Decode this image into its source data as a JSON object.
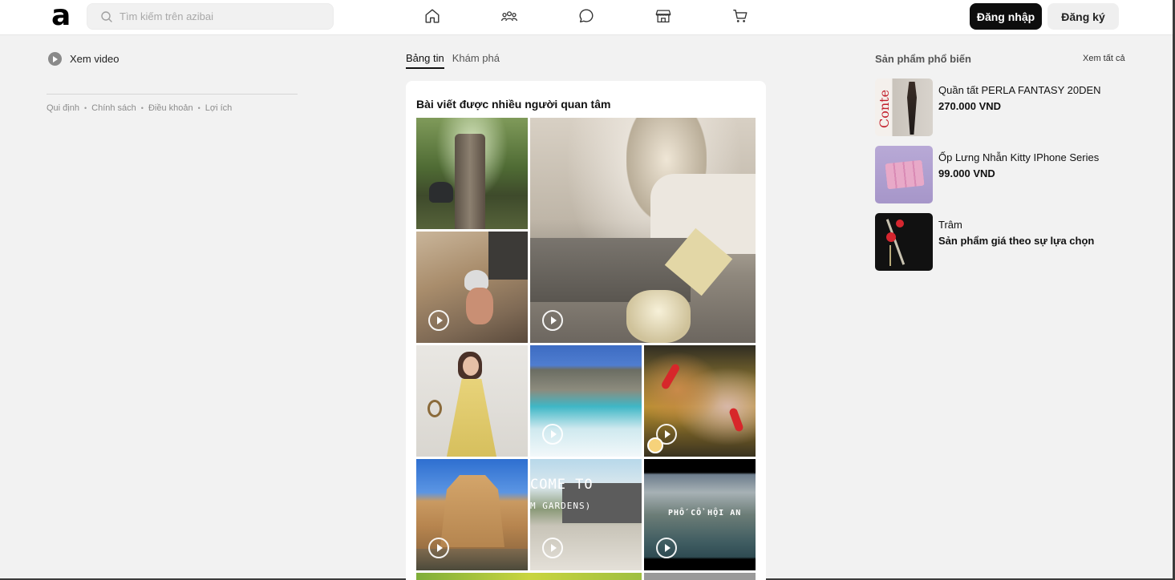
{
  "header": {
    "logo_text": "a",
    "search_placeholder": "Tìm kiếm trên azibai",
    "nav_icons": [
      "home-icon",
      "groups-icon",
      "chat-icon",
      "store-icon",
      "cart-icon"
    ],
    "login_label": "Đăng nhập",
    "register_label": "Đăng ký"
  },
  "sidebar": {
    "watch_video_label": "Xem video",
    "links": [
      "Qui định",
      "Chính sách",
      "Điều khoản",
      "Lợi ích"
    ]
  },
  "feed": {
    "tabs": [
      {
        "label": "Bảng tin",
        "active": true
      },
      {
        "label": "Khám phá",
        "active": false
      }
    ],
    "section_title": "Bài viết được nhiều người quan tâm",
    "tile_overlays": {
      "welcome_line1": "COME TO",
      "welcome_line2": "M GARDENS)",
      "hoian": "PHỐ CỔ HỘI AN"
    }
  },
  "right_panel": {
    "title": "Sản phẩm phổ biến",
    "see_all": "Xem tất cả",
    "products": [
      {
        "name": "Quần tất PERLA FANTASY 20DEN",
        "price": "270.000 VND"
      },
      {
        "name": "Ốp Lưng Nhẫn Kitty IPhone Series",
        "price": "99.000 VND"
      },
      {
        "name": "Trâm",
        "price": "Sản phẩm giá theo sự lựa chọn"
      }
    ]
  },
  "colors": {
    "background": "#f2f2f2",
    "primary_button": "#0d0d0d",
    "secondary_button": "#efefef",
    "card": "#ffffff"
  }
}
